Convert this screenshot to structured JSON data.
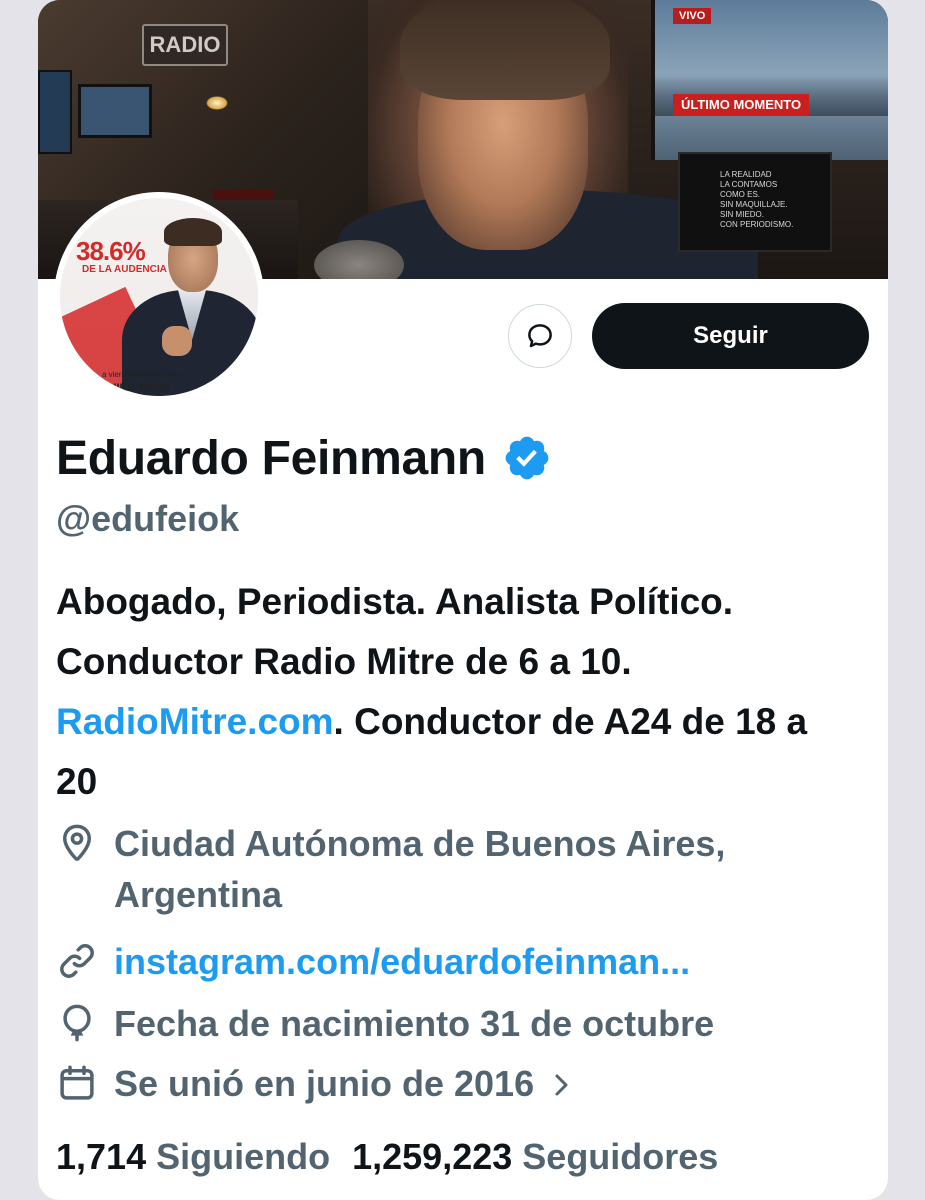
{
  "banner": {
    "radio_sign": "RADIO",
    "tv_badge": "VIVO",
    "tv_headline": "ÚLTIMO MOMENTO",
    "prompter_text": "LA REALIDAD\nLA CONTAMOS\nCOMO ES.\nSIN MAQUILLAJE.\nSIN MIEDO.\nCON PERIODISMO."
  },
  "avatar": {
    "stat": "38.6%",
    "stat_caption": "DE LA AUDENCIA",
    "schedule": "a viernes de 06 a 10hs",
    "tagline": "QUIEN TIENE"
  },
  "actions": {
    "message_icon": "message-bubble-icon",
    "follow_label": "Seguir"
  },
  "profile": {
    "name": "Eduardo Feinmann",
    "verified_icon": "verified-badge-icon",
    "verified_color": "#1d9bf0",
    "handle": "@edufeiok",
    "bio_part1": "Abogado, Periodista. Analista Político. Conductor Radio Mitre de 6 a 10. ",
    "bio_link": "RadioMitre.com",
    "bio_part2": ". Conductor de A24 de 18 a 20",
    "location": "Ciudad Autónoma de Buenos Aires, Argentina",
    "website": "instagram.com/eduardofeinman...",
    "birthday": "Fecha de nacimiento 31 de octubre",
    "joined": "Se unió en junio de 2016"
  },
  "stats": {
    "following_count": "1,714",
    "following_label": "Siguiendo",
    "followers_count": "1,259,223",
    "followers_label": "Seguidores"
  },
  "colors": {
    "text_primary": "#0f1419",
    "text_secondary": "#536471",
    "accent": "#1d9bf0"
  }
}
